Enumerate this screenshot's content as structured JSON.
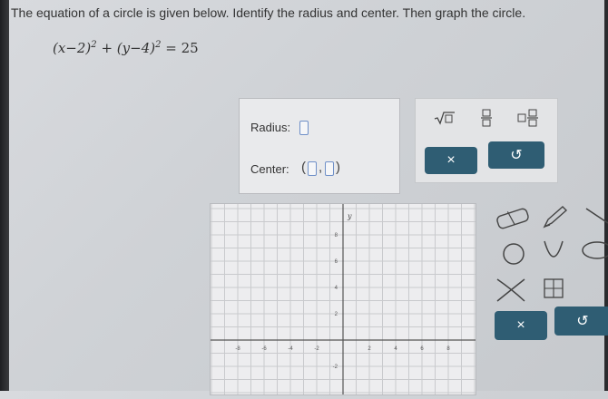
{
  "question": {
    "text": "The equation of a circle is given below. Identify the radius and center. Then graph the circle."
  },
  "equation": {
    "lhs_a": "(x−2)",
    "exp_a": "2",
    "plus": "+",
    "lhs_b": "(y−4)",
    "exp_b": "2",
    "rhs": "= 25"
  },
  "answer": {
    "radius_label": "Radius:",
    "radius_value": "",
    "center_label": "Center:",
    "center_open": "(",
    "center_comma": ",",
    "center_close": ")",
    "center_x": "",
    "center_y": ""
  },
  "toolbar": {
    "sqrt_icon": "sqrt-icon",
    "fraction_icon": "fraction-icon",
    "mixed_icon": "mixed-number-icon",
    "clear_label": "×",
    "undo_label": "↺"
  },
  "graph": {
    "y_axis_label": "y",
    "x_ticks": [
      "-8",
      "-6",
      "-4",
      "-2",
      "2",
      "4",
      "6",
      "8"
    ],
    "y_ticks": [
      "8",
      "6",
      "4",
      "2",
      "-2"
    ]
  },
  "draw_tools": {
    "clear_label": "×",
    "undo_label": "↺"
  },
  "colors": {
    "accent": "#2f5d73",
    "input_border": "#6f90c8"
  }
}
